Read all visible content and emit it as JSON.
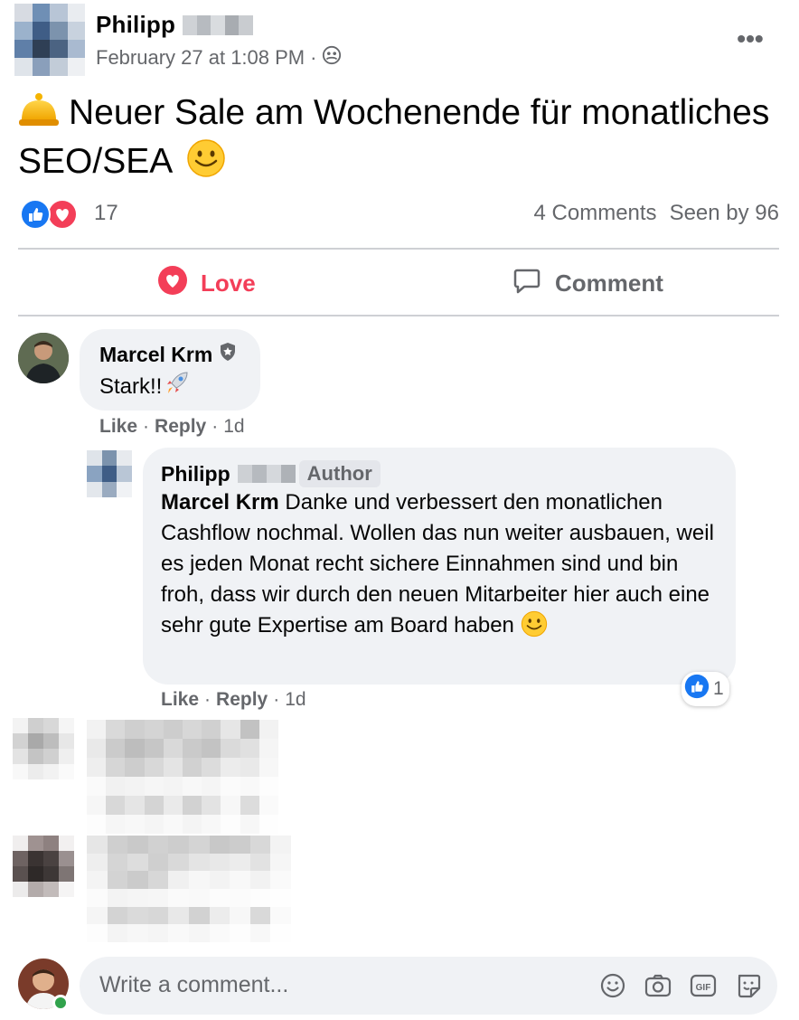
{
  "post": {
    "author_first_name": "Philipp",
    "timestamp": "February 27 at 1:08 PM",
    "privacy_separator": "·",
    "privacy_icon": "group-members-icon",
    "more_label": "•••",
    "text": "Neuer Sale am Wochenende für monatliches SEO/SEA",
    "reaction_count": "17",
    "comments_count": "4 Comments",
    "seen_by": "Seen by 96"
  },
  "actions": {
    "love_label": "Love",
    "comment_label": "Comment"
  },
  "comments": [
    {
      "name": "Marcel Krm",
      "text": "Stark!!",
      "like": "Like",
      "reply": "Reply",
      "age": "1d"
    }
  ],
  "reply": {
    "name": "Philipp",
    "badge": "Author",
    "mention": "Marcel Krm",
    "text": "Danke und verbessert den monatlichen Cashflow nochmal. Wollen das nun weiter ausbauen, weil es jeden Monat recht sichere Einnahmen sind und bin froh, dass wir durch den neuen Mitarbeiter hier auch eine sehr gute Expertise am Board haben",
    "reaction_count": "1",
    "like": "Like",
    "reply": "Reply",
    "age": "1d"
  },
  "composer": {
    "placeholder": "Write a comment..."
  },
  "colors": {
    "love": "#f33e58",
    "like_blue": "#1877f2",
    "bubble": "#f0f2f5",
    "muted": "#65676b"
  }
}
